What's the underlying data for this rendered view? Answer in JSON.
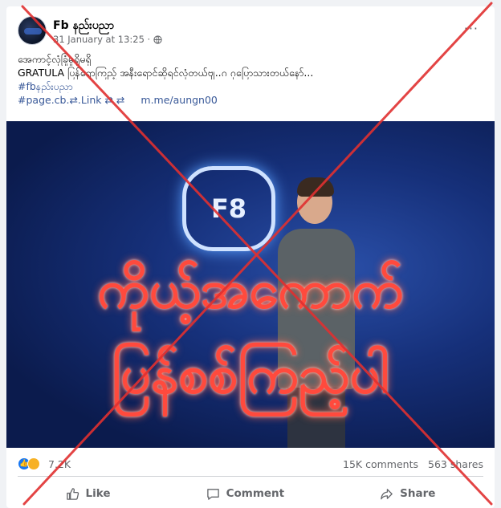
{
  "post": {
    "author": "Fb နည်းပညာ",
    "timestamp": "31 January at 13:25 ·",
    "more_label": "···",
    "lines": [
      "အေကာင့်လုံခြုံမှုရှိမရှိ",
      "GRATULA ပြန်ရောကြည့် အနီးရောင်ဆိုရင်လုံတယ်ဗျ..ဂ ဂုပြောသားတယ်နော်..."
    ],
    "hashtag": "#fbနည်းပညာ",
    "page_tag": "#page.cb.⇄.Link ⇄ ⇄",
    "link": "m.me/aungn00"
  },
  "photo": {
    "logo_text": "F8",
    "caption_line1": "ကိုယ့်အကောက်",
    "caption_line2": "ပြန်စစ်ကြည့်ပါ"
  },
  "stats": {
    "reactions": "7.2K",
    "comments": "15K comments",
    "shares": "563 shares"
  },
  "actions": {
    "like": "Like",
    "comment": "Comment",
    "share": "Share"
  },
  "colors": {
    "link_blue": "#385898",
    "like_blue": "#1877f2",
    "x_mark_red": "#e03030"
  }
}
